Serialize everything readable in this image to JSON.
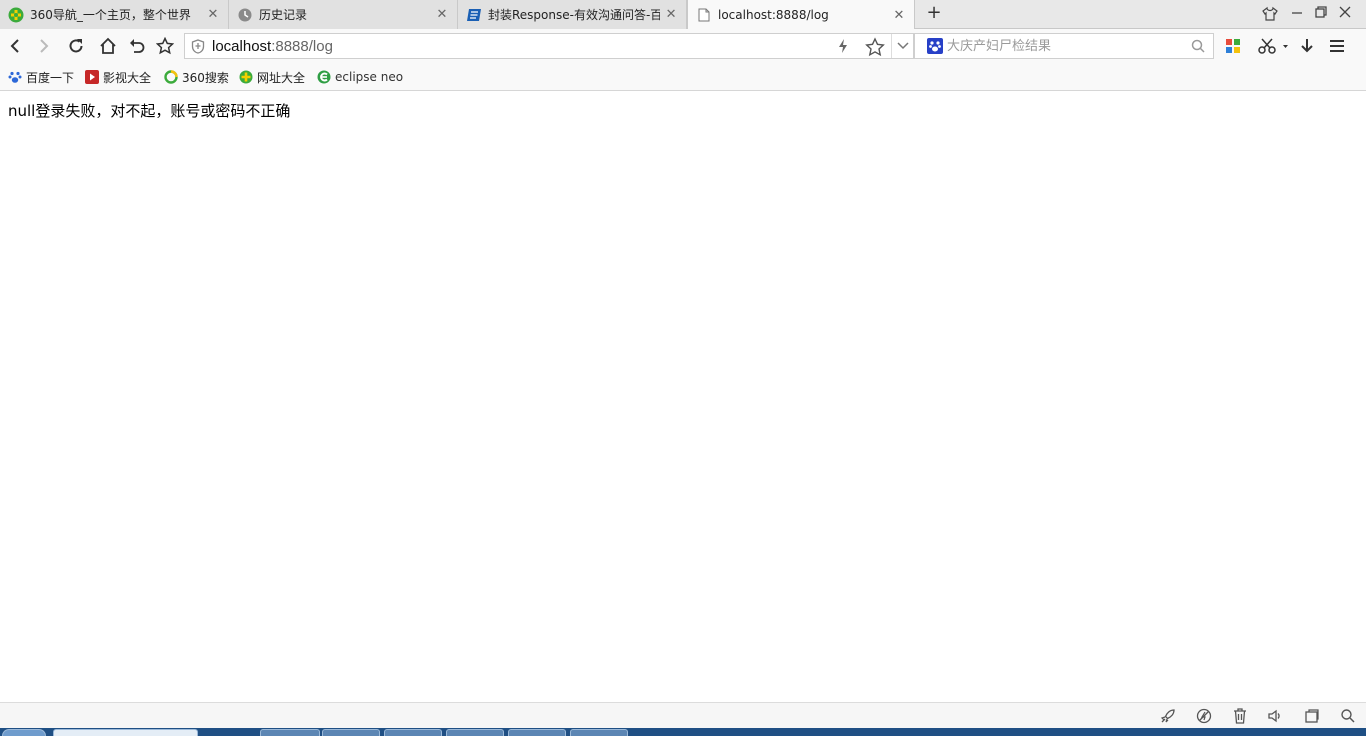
{
  "tabs": [
    {
      "title": "360导航_一个主页，整个世界",
      "icon": "360-nav-icon",
      "active": false
    },
    {
      "title": "历史记录",
      "icon": "history-clock-icon",
      "active": false
    },
    {
      "title": "封装Response-有效沟通问答-百",
      "icon": "document-blue-icon",
      "active": false
    },
    {
      "title": "localhost:8888/log",
      "icon": "blank-page-icon",
      "active": true
    }
  ],
  "address_bar": {
    "host": "localhost",
    "rest": ":8888/log"
  },
  "search": {
    "placeholder": "大庆产妇尸检结果"
  },
  "bookmarks": [
    {
      "label": "百度一下",
      "icon": "baidu-paw-icon"
    },
    {
      "label": "影视大全",
      "icon": "video-play-icon"
    },
    {
      "label": "360搜索",
      "icon": "360-search-icon"
    },
    {
      "label": "网址大全",
      "icon": "360-nav-icon"
    },
    {
      "label": "eclipse neo",
      "icon": "eclipse-icon"
    }
  ],
  "page": {
    "message": "null登录失败，对不起，账号或密码不正确"
  },
  "colors": {
    "tab_bg": "#e1e1e1",
    "active_tab_bg": "#f9f9f9",
    "toolbar_bg": "#f9f9f9",
    "taskbar": "#1f4f84"
  }
}
